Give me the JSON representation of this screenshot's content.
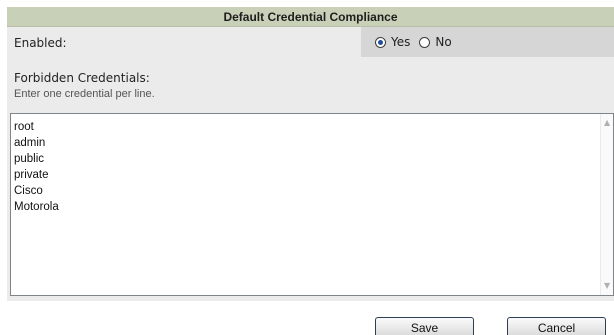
{
  "panel": {
    "title": "Default Credential Compliance"
  },
  "enabled": {
    "label": "Enabled:",
    "options": [
      {
        "label": "Yes",
        "selected": true
      },
      {
        "label": "No",
        "selected": false
      }
    ]
  },
  "forbidden": {
    "title": "Forbidden Credentials:",
    "hint": "Enter one credential per line.",
    "credentials": [
      "root",
      "admin",
      "public",
      "private",
      "Cisco",
      "Motorola"
    ]
  },
  "buttons": {
    "save": "Save",
    "cancel": "Cancel"
  },
  "colors": {
    "header_bg": "#c9d0b8",
    "panel_bg": "#ebebeb",
    "radio_cell_bg": "#d6d6d6",
    "button_border": "#2f3d55"
  }
}
